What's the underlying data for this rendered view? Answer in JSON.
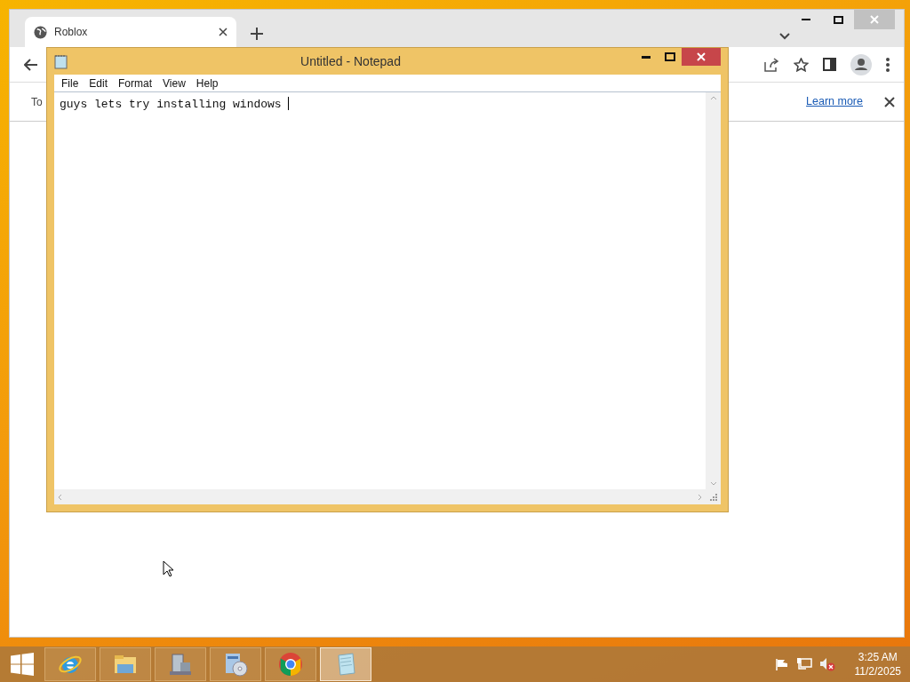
{
  "browser": {
    "tabs": [
      {
        "title": "Roblox",
        "selected": true
      }
    ],
    "infobar": {
      "text": "To",
      "link": "Learn more"
    }
  },
  "notepad": {
    "title": "Untitled - Notepad",
    "menu": [
      "File",
      "Edit",
      "Format",
      "View",
      "Help"
    ],
    "text": "guys lets try installing windows "
  },
  "taskbar": {
    "apps": [
      {
        "kind": "ie",
        "selected": false
      },
      {
        "kind": "explorer",
        "selected": false
      },
      {
        "kind": "device",
        "selected": false
      },
      {
        "kind": "setup",
        "selected": false
      },
      {
        "kind": "chrome",
        "selected": false
      },
      {
        "kind": "notepad",
        "selected": true
      }
    ],
    "clock": {
      "time": "3:25 AM",
      "date": "11/2/2025"
    }
  }
}
